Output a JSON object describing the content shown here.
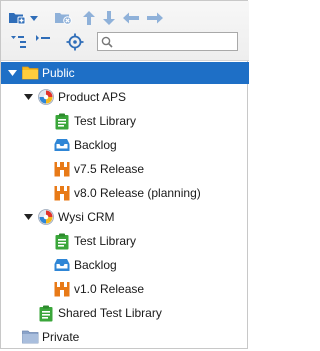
{
  "toolbar": {
    "buttons": [
      {
        "name": "new-folder-icon"
      },
      {
        "name": "dropdown-arrow-icon"
      },
      {
        "name": "delete-folder-icon"
      },
      {
        "name": "move-up-icon"
      },
      {
        "name": "move-down-icon"
      },
      {
        "name": "move-left-icon"
      },
      {
        "name": "move-right-icon"
      },
      {
        "name": "expand-all-icon"
      },
      {
        "name": "collapse-all-icon"
      },
      {
        "name": "locate-icon"
      }
    ]
  },
  "search": {
    "placeholder": "",
    "value": ""
  },
  "colors": {
    "selection": "#1e6fc6",
    "folder": "#f5b81c",
    "library": "#3aa63a",
    "backlog": "#2f86d6",
    "release": "#e87a17",
    "private_folder": "#8aa3c9"
  },
  "tree": {
    "root": {
      "label": "Public",
      "expanded": true,
      "selected": true
    },
    "projects": [
      {
        "label": "Product APS",
        "expanded": true,
        "children": [
          {
            "label": "Test Library",
            "type": "library"
          },
          {
            "label": "Backlog",
            "type": "backlog"
          },
          {
            "label": "v7.5 Release",
            "type": "release"
          },
          {
            "label": "v8.0 Release (planning)",
            "type": "release"
          }
        ]
      },
      {
        "label": "Wysi CRM",
        "expanded": true,
        "children": [
          {
            "label": "Test Library",
            "type": "library"
          },
          {
            "label": "Backlog",
            "type": "backlog"
          },
          {
            "label": "v1.0 Release",
            "type": "release"
          }
        ]
      }
    ],
    "shared": {
      "label": "Shared Test Library",
      "type": "library"
    },
    "private": {
      "label": "Private"
    }
  }
}
